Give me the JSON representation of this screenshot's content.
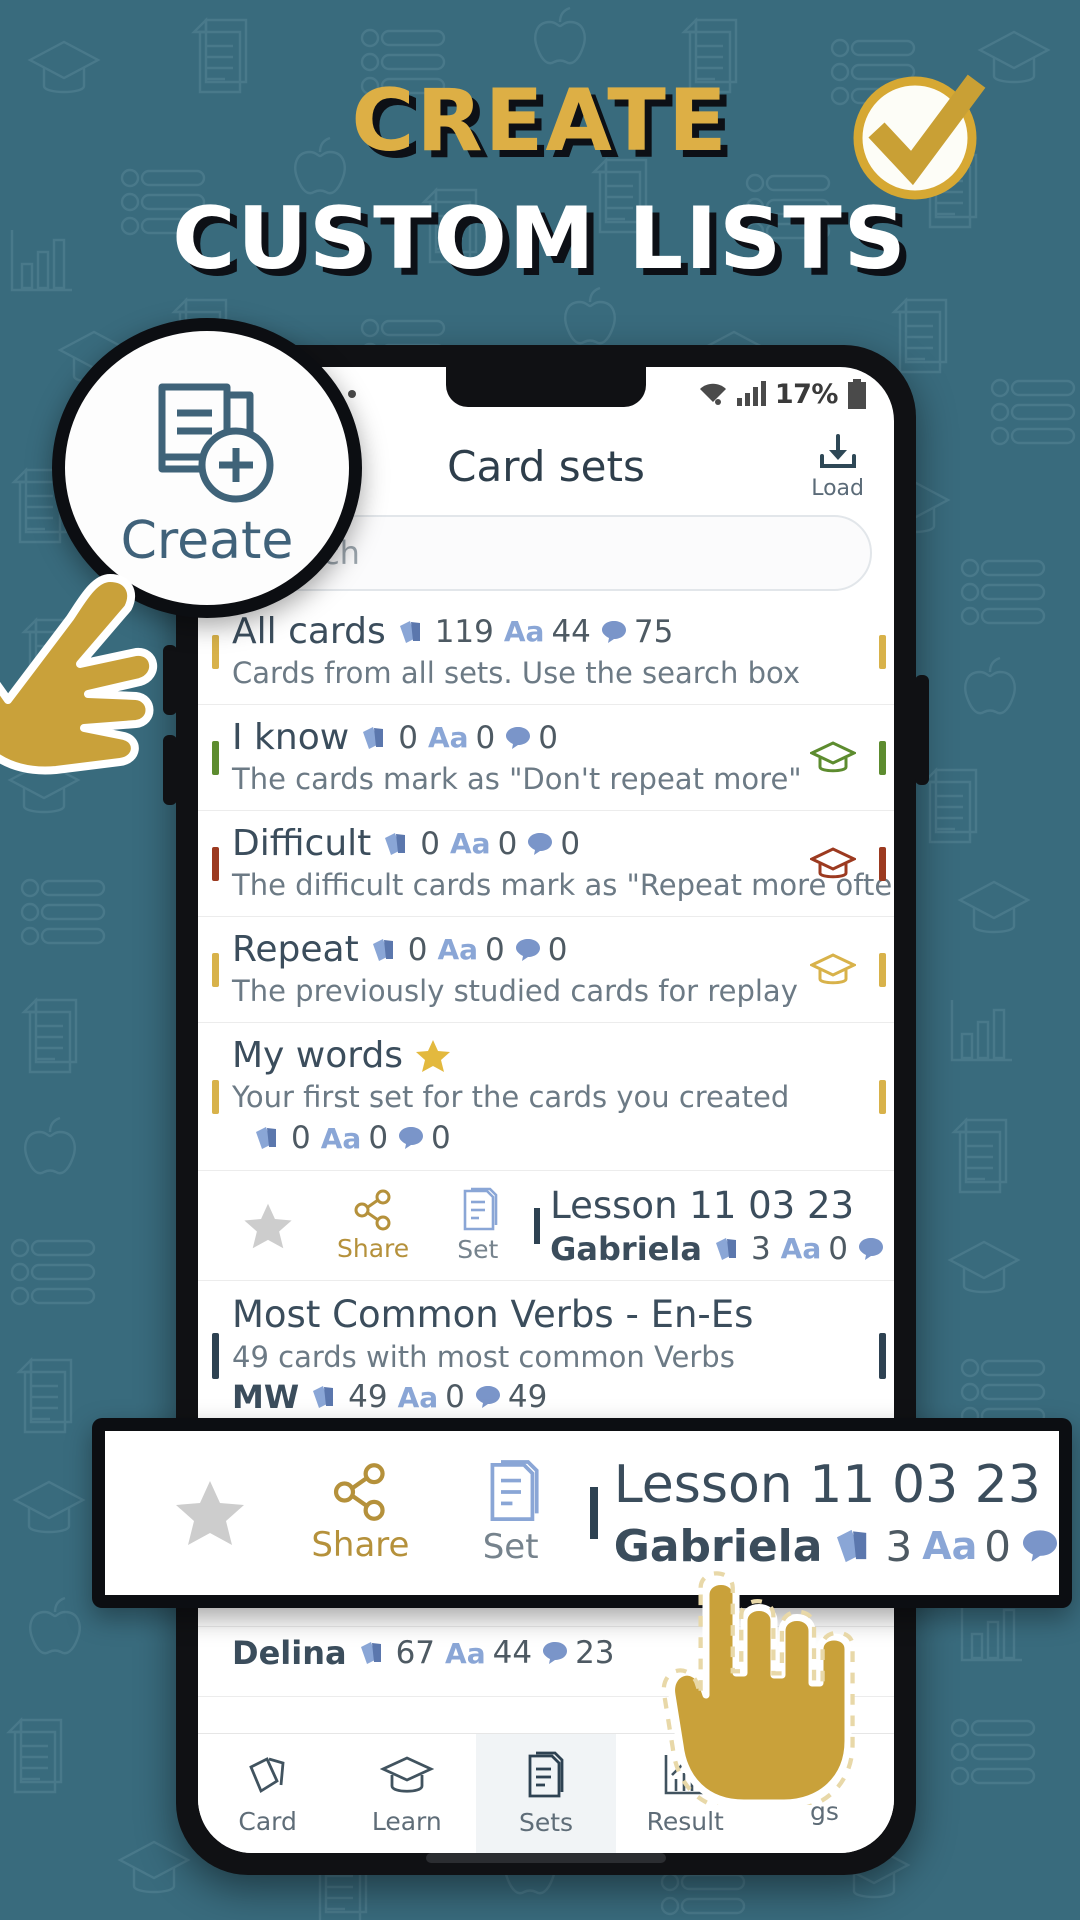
{
  "promo": {
    "headline_line1": "CREATE",
    "headline_line2": "CUSTOM LISTS",
    "gold": "#ddaf45",
    "white": "#ffffff",
    "background": "#3a6b7e",
    "badge_icon": "check-circle-icon"
  },
  "create_callout": {
    "label": "Create",
    "icon": "create-new-set-icon"
  },
  "phone": {
    "statusbar": {
      "left_icons": [
        "cloud-icon",
        "screenshot-icon",
        "settings-icon",
        "dot-icon"
      ],
      "wifi_icon": "wifi-icon",
      "signal_icon": "cellular-signal-icon",
      "battery_percent": "17%",
      "battery_icon": "battery-icon"
    },
    "appbar": {
      "title": "Card sets",
      "load_label": "Load",
      "load_icon": "download-icon"
    },
    "search": {
      "placeholder": "Search",
      "icon": "search-icon"
    },
    "list": [
      {
        "title": "All cards",
        "desc": "Cards from all sets. Use the search box",
        "cards": "119",
        "aa": "44",
        "comments": "75",
        "bar_color": "#d8b24a",
        "cap": null,
        "star": false
      },
      {
        "title": "I know",
        "desc": "The cards mark as \"Don't repeat more\"",
        "cards": "0",
        "aa": "0",
        "comments": "0",
        "bar_color": "#5d8c2f",
        "cap": "#5d8c2f",
        "star": false
      },
      {
        "title": "Difficult",
        "desc": "The difficult cards mark as \"Repeat more often\"",
        "cards": "0",
        "aa": "0",
        "comments": "0",
        "bar_color": "#9c3a20",
        "cap": "#9c3a20",
        "star": false
      },
      {
        "title": "Repeat",
        "desc": "The previously studied cards for replay",
        "cards": "0",
        "aa": "0",
        "comments": "0",
        "bar_color": "#d8b24a",
        "cap": "#d8b24a",
        "star": false
      },
      {
        "title": "My words",
        "desc": "Your first set for the cards you created",
        "cards": "0",
        "aa": "0",
        "comments": "0",
        "bar_color": "#d8b24a",
        "cap": null,
        "star": true
      }
    ],
    "set_row": {
      "star_icon": "star-icon",
      "share_label": "Share",
      "share_icon": "share-icon",
      "set_label": "Set",
      "set_icon": "set-document-icon",
      "title": "Lesson 11 03 23",
      "author": "Gabriela",
      "cards": "3",
      "aa": "0"
    },
    "verbs_row": {
      "title": "Most Common Verbs - En-Es",
      "desc": "49 cards with most common Verbs",
      "author": "MW",
      "cards": "49",
      "aa": "0",
      "comments": "49"
    },
    "delina_row": {
      "author": "Delina",
      "cards": "67",
      "aa": "44",
      "comments": "23"
    },
    "bottomnav": [
      {
        "label": "Card",
        "icon": "cards-icon",
        "active": false
      },
      {
        "label": "Learn",
        "icon": "graduation-cap-icon",
        "active": false
      },
      {
        "label": "Sets",
        "icon": "sets-document-icon",
        "active": true
      },
      {
        "label": "Result",
        "icon": "chart-icon",
        "active": false
      },
      {
        "label": "gs",
        "icon": "settings-icon",
        "active": false
      }
    ]
  },
  "mag_callout": {
    "star_icon": "star-icon",
    "share_label": "Share",
    "share_icon": "share-icon",
    "set_label": "Set",
    "set_icon": "set-document-icon",
    "title": "Lesson 11 03 23",
    "author": "Gabriela",
    "cards": "3",
    "aa": "0"
  }
}
